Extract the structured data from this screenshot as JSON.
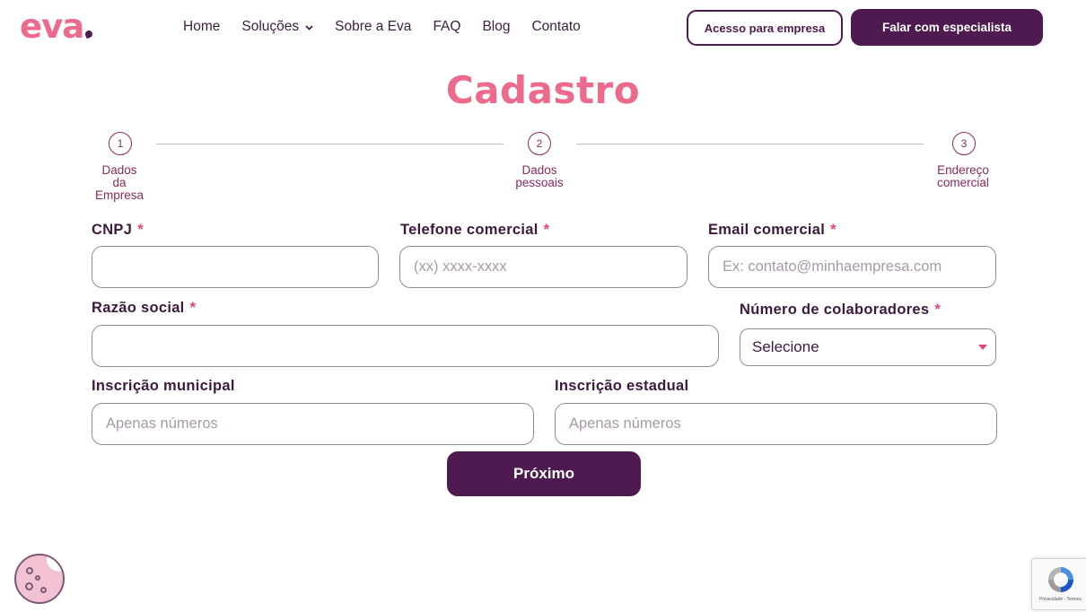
{
  "header": {
    "logo_text": "eva",
    "nav": [
      {
        "label": "Home"
      },
      {
        "label": "Soluções",
        "has_dropdown": true
      },
      {
        "label": "Sobre a Eva"
      },
      {
        "label": "FAQ"
      },
      {
        "label": "Blog"
      },
      {
        "label": "Contato"
      }
    ],
    "company_access_label": "Acesso para empresa",
    "specialist_label": "Falar com especialista"
  },
  "page_title": "Cadastro",
  "steps": [
    {
      "number": "1",
      "label_lines": [
        "Dados",
        "da",
        "Empresa"
      ]
    },
    {
      "number": "2",
      "label_lines": [
        "Dados",
        "pessoais"
      ]
    },
    {
      "number": "3",
      "label_lines": [
        "Endereço",
        "comercial"
      ]
    }
  ],
  "form": {
    "required_mark": "*",
    "cnpj": {
      "label": "CNPJ",
      "value": "",
      "placeholder": ""
    },
    "phone": {
      "label": "Telefone comercial",
      "value": "",
      "placeholder": "(xx) xxxx-xxxx"
    },
    "email": {
      "label": "Email comercial",
      "value": "",
      "placeholder": "Ex: contato@minhaempresa.com"
    },
    "company_name": {
      "label": "Razão social",
      "value": "",
      "placeholder": ""
    },
    "employees": {
      "label": "Número de colaboradores",
      "selected": "Selecione"
    },
    "municipal_reg": {
      "label": "Inscrição municipal",
      "value": "",
      "placeholder": "Apenas números"
    },
    "state_reg": {
      "label": "Inscrição estadual",
      "value": "",
      "placeholder": "Apenas números"
    },
    "next_label": "Próximo"
  },
  "recaptcha": {
    "footer_text": "Privacidade - Termos"
  },
  "colors": {
    "brand_pink": "#ec6a8c",
    "brand_purple": "#4e1a4f",
    "required_red": "#e0456f"
  },
  "icons": {
    "cookie": "cookie-icon",
    "recaptcha": "recaptcha-icon",
    "dropdown": "chevron-down-icon"
  }
}
